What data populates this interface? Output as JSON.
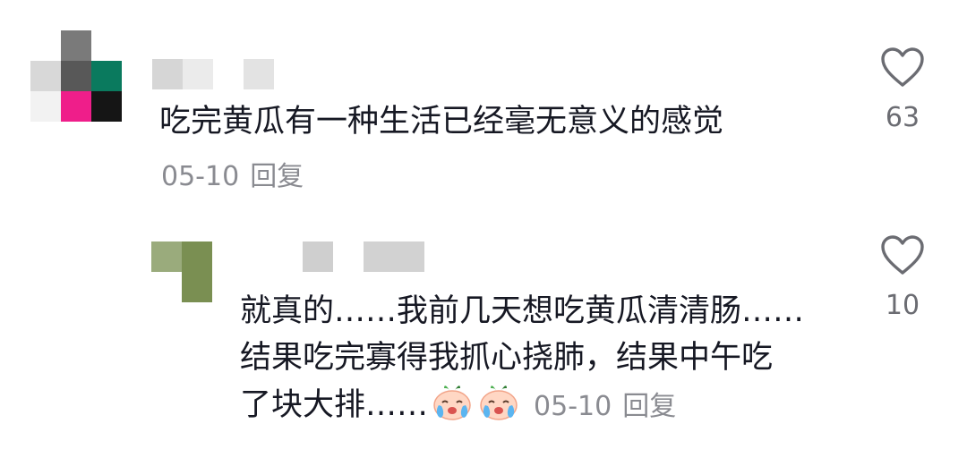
{
  "comment": {
    "text": "吃完黄瓜有一种生活已经毫无意义的感觉",
    "date": "05-10",
    "reply_label": "回复",
    "like_count": "63",
    "like_icon": "heart-outline-icon"
  },
  "reply": {
    "lines": [
      "就真的……我前几天想吃黄瓜清清肠……",
      "结果吃完寡得我抓心挠肺，结果中午吃",
      "了块大排……"
    ],
    "emoji": [
      "crying-face-emoji",
      "crying-face-emoji"
    ],
    "date": "05-10",
    "reply_label": "回复",
    "like_count": "10",
    "like_icon": "heart-outline-icon"
  },
  "colors": {
    "text": "#161823",
    "meta": "#8a8b91",
    "count": "#6b6c72",
    "avatar_main": [
      "#7a7a7a",
      "#d8d8d8",
      "#585858",
      "#0a7a5e",
      "#e6e6e6",
      "#ef1e8a",
      "#151515",
      "#f2f2f2"
    ],
    "avatar_reply": [
      "#9aab7c",
      "#7a8f52"
    ]
  }
}
